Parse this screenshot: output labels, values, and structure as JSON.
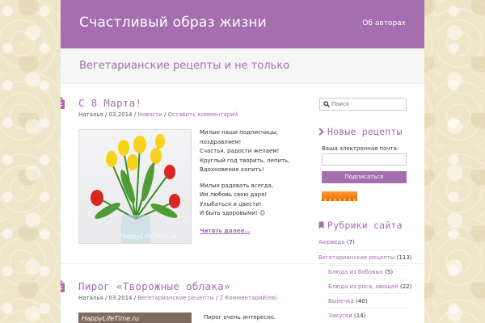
{
  "header": {
    "site_title": "Счастливый образ жизни",
    "about_link": "Об авторах"
  },
  "tagline": "Вегетарианские рецепты и не только",
  "posts": [
    {
      "title": "С 8 Марта!",
      "author": "Наталья",
      "date": "03.2014",
      "category": "Новости",
      "comments": "Оставить комментарий",
      "photo_watermark": "HappyLifeTime.ru",
      "poem": [
        "Милые наши подписчицы,",
        "поздравляем!",
        "Счастья, радости желаем!",
        "Круглый год творить, лепить,",
        "Вдохновение копить!",
        "",
        "Милых радовать всегда,",
        "Им любовь свою даря!",
        "Улыбаться и цвести!",
        "И быть здоровыми! ☺"
      ],
      "read_more": "Читать далее…"
    },
    {
      "title": "Пирог «Творожные облака»",
      "author": "Наталья",
      "date": "03.2014",
      "category": "Вегетарианские рецепты",
      "comments": "2 Комментарий(ев)",
      "photo_watermark": "HappyLifeTime.ru",
      "snippet": "Пирог очень интересно."
    }
  ],
  "sidebar": {
    "search_placeholder": "Поиск",
    "subscribe": {
      "title": "Новые рецепты",
      "email_label": "Ваша электронная почта:",
      "button": "Подписаться"
    },
    "categories": {
      "title": "Рубрики сайта",
      "items": [
        {
          "name": "Аюрведа",
          "count": "(7)"
        },
        {
          "name": "Вегетарианские рецепты",
          "count": "(113)"
        },
        {
          "name": "Блюда из бобовых",
          "count": "(5)"
        },
        {
          "name": "Блюда из риса, овощей",
          "count": "(22)"
        },
        {
          "name": "Выпечка",
          "count": "(40)"
        },
        {
          "name": "Закуски",
          "count": "(14)"
        }
      ]
    }
  },
  "colors": {
    "accent": "#a56eaf",
    "background": "#efe6c9",
    "feed_badge": "#f07a10"
  }
}
